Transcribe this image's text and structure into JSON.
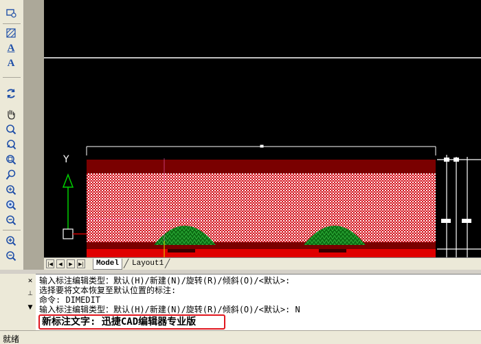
{
  "toolbar": {
    "icons": [
      "block-insert-icon",
      "hatch-icon",
      "multiline-text-icon",
      "single-line-text-icon",
      "undo-redo-icon",
      "pan-hand-icon",
      "zoom-realtime-icon",
      "zoom-previous-icon",
      "zoom-window-icon",
      "zoom-dynamic-icon",
      "zoom-scale-icon",
      "zoom-center-icon",
      "zoom-in-icon",
      "zoom-out-icon",
      "zoom-all-icon",
      "zoom-extents-icon",
      "aerial-view-icon"
    ],
    "text_tool_letter_1": "A",
    "text_tool_letter_2": "A"
  },
  "canvas": {
    "background": "#000000",
    "ucs_y_label": "Y"
  },
  "tabs": {
    "model": "Model",
    "layout1": "Layout1"
  },
  "command": {
    "lines": [
      "输入标注编辑类型：默认(H)/新建(N)/旋转(R)/倾斜(O)/<默认>:",
      "选择要将文本恢复至默认位置的标注:",
      "命令:  DIMEDIT",
      "输入标注编辑类型：默认(H)/新建(N)/旋转(R)/倾斜(O)/<默认>: N"
    ],
    "current_input": "新标注文字: 迅捷CAD编辑器专业版",
    "highlight_color": "#e0141c"
  },
  "status": {
    "text": "就绪"
  }
}
